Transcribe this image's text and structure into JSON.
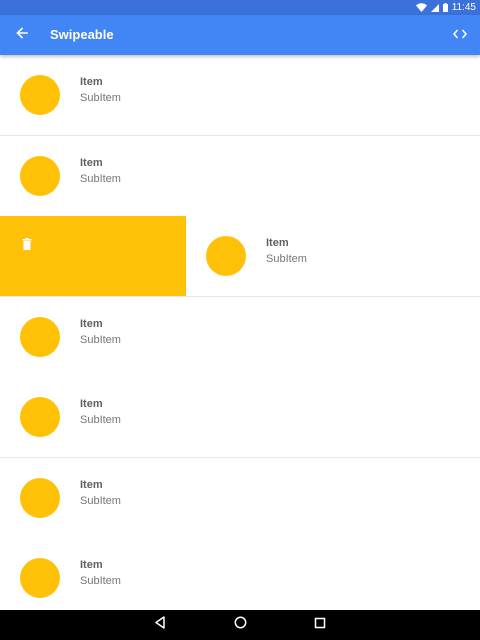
{
  "status_bar": {
    "time": "11:45",
    "icons": [
      "wifi-icon",
      "signal-icon",
      "battery-icon"
    ],
    "color": "#3b71d9"
  },
  "app_bar": {
    "title": "Swipeable",
    "back_icon": "arrow-back-icon",
    "action_icon": "code-icon",
    "color": "#4285f4"
  },
  "list": {
    "items": [
      {
        "title": "Item",
        "subtitle": "SubItem"
      },
      {
        "title": "Item",
        "subtitle": "SubItem"
      },
      {
        "title": "Item",
        "subtitle": "SubItem",
        "swiped": true,
        "action_icon": "trash-icon"
      },
      {
        "title": "Item",
        "subtitle": "SubItem"
      },
      {
        "title": "Item",
        "subtitle": "SubItem"
      },
      {
        "title": "Item",
        "subtitle": "SubItem"
      },
      {
        "title": "Item",
        "subtitle": "SubItem"
      }
    ],
    "accent_color": "#ffc107"
  },
  "nav_bar": {
    "icons": [
      "back-triangle-icon",
      "home-circle-icon",
      "recents-square-icon"
    ]
  }
}
